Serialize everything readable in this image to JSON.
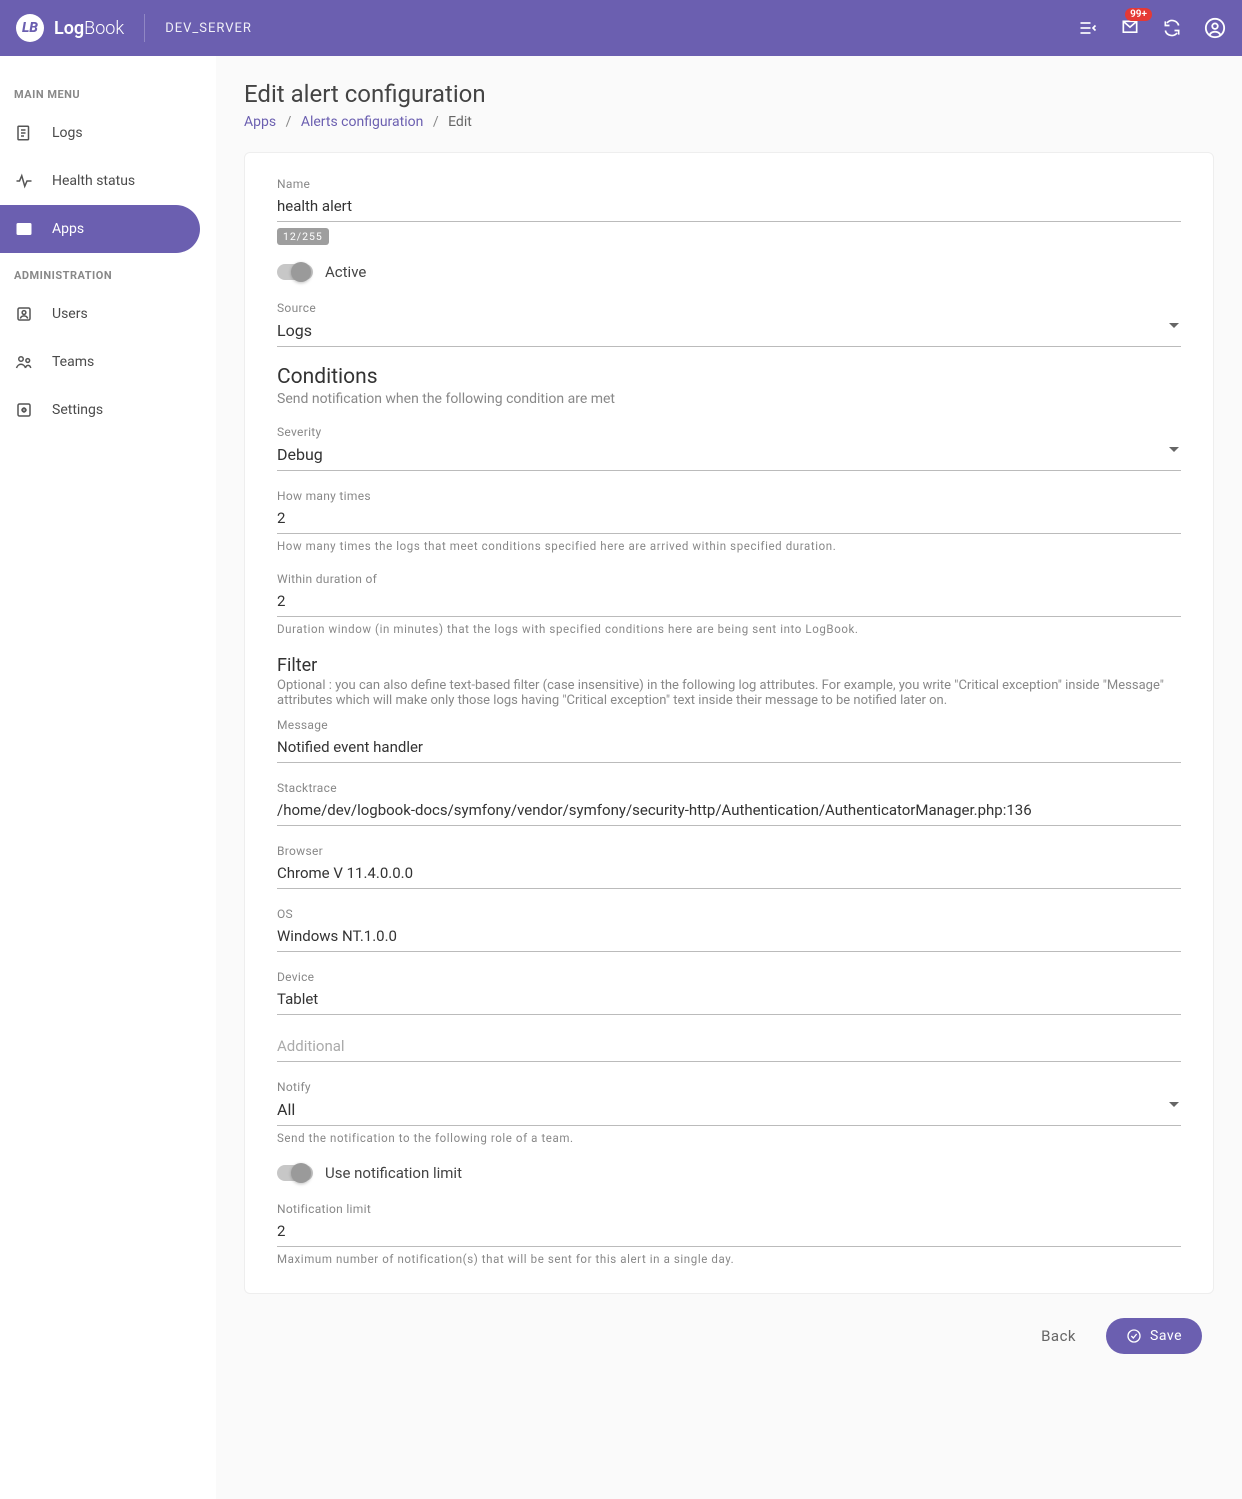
{
  "topbar": {
    "brand_strong": "Log",
    "brand_light": "Book",
    "env": "DEV_SERVER",
    "notif_badge": "99+"
  },
  "sidebar": {
    "sections": {
      "main_menu": "MAIN MENU",
      "administration": "ADMINISTRATION"
    },
    "items": {
      "logs": "Logs",
      "health_status": "Health status",
      "apps": "Apps",
      "users": "Users",
      "teams": "Teams",
      "settings": "Settings"
    }
  },
  "page": {
    "title": "Edit alert configuration",
    "breadcrumb": {
      "l1": "Apps",
      "l2": "Alerts configuration",
      "l3": "Edit"
    }
  },
  "form": {
    "name_label": "Name",
    "name_value": "health alert",
    "char_counter": "12/255",
    "active_label": "Active",
    "source_label": "Source",
    "source_value": "Logs",
    "conditions_heading": "Conditions",
    "conditions_sub": "Send notification when the following condition are met",
    "severity_label": "Severity",
    "severity_value": "Debug",
    "how_many_label": "How many times",
    "how_many_value": "2",
    "how_many_hint": "How many times the logs that meet conditions specified here are arrived within specified duration.",
    "duration_label": "Within duration of",
    "duration_value": "2",
    "duration_hint": "Duration window (in minutes) that the logs with specified conditions here are being sent into LogBook.",
    "filter_heading": "Filter",
    "filter_desc": "Optional : you can also define text-based filter (case insensitive) in the following log attributes. For example, you write \"Critical exception\" inside \"Message\" attributes which will make only those logs having \"Critical exception\" text inside their message to be notified later on.",
    "message_label": "Message",
    "message_value": "Notified event handler",
    "stacktrace_label": "Stacktrace",
    "stacktrace_value": "/home/dev/logbook-docs/symfony/vendor/symfony/security-http/Authentication/AuthenticatorManager.php:136",
    "browser_label": "Browser",
    "browser_value": "Chrome V 11.4.0.0.0",
    "os_label": "OS",
    "os_value": "Windows NT.1.0.0",
    "device_label": "Device",
    "device_value": "Tablet",
    "additional_placeholder": "Additional",
    "notify_label": "Notify",
    "notify_value": "All",
    "notify_hint": "Send the notification to the following role of a team.",
    "use_limit_label": "Use notification limit",
    "notif_limit_label": "Notification limit",
    "notif_limit_value": "2",
    "notif_limit_hint": "Maximum number of notification(s) that will be sent for this alert in a single day.",
    "back_button": "Back",
    "save_button": "Save"
  }
}
